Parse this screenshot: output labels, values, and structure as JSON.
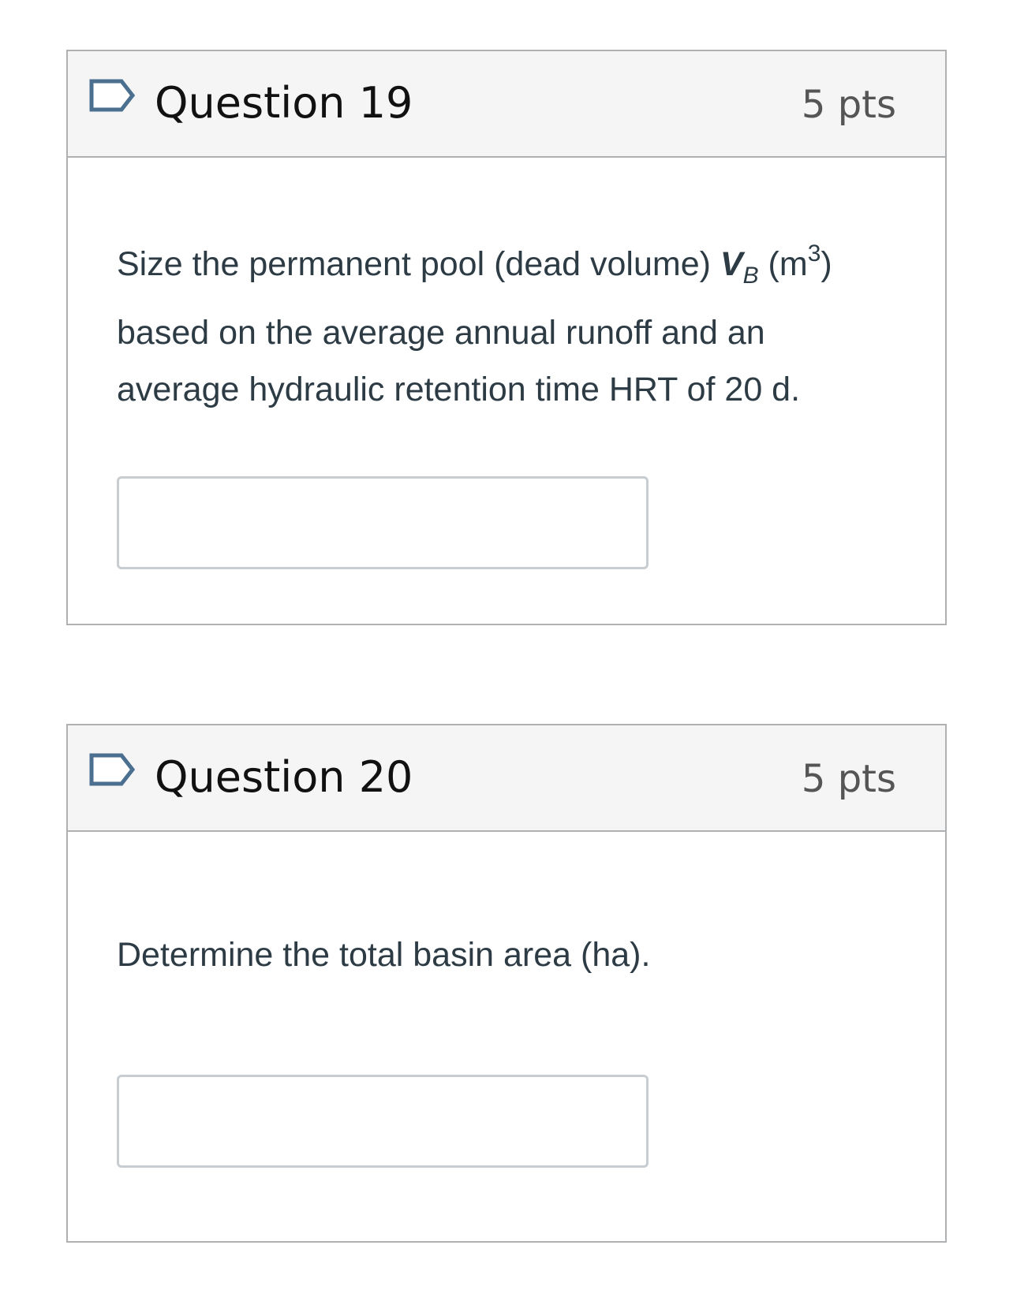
{
  "questions": [
    {
      "title": "Question 19",
      "points": "5 pts",
      "text_before": "Size the permanent pool (dead volume) ",
      "var_main": "V",
      "var_sub": "B",
      "unit_open": " (m",
      "unit_sup": "3",
      "unit_close": ")",
      "text_after": "based on the average annual runoff and an average hydraulic retention time HRT of 20 d.",
      "answer_value": ""
    },
    {
      "title": "Question 20",
      "points": "5 pts",
      "text": "Determine the total basin area (ha).",
      "answer_value": ""
    }
  ],
  "icons": {
    "flag": "bookmark-flag-icon",
    "flag_color": "#4a6f8f"
  }
}
